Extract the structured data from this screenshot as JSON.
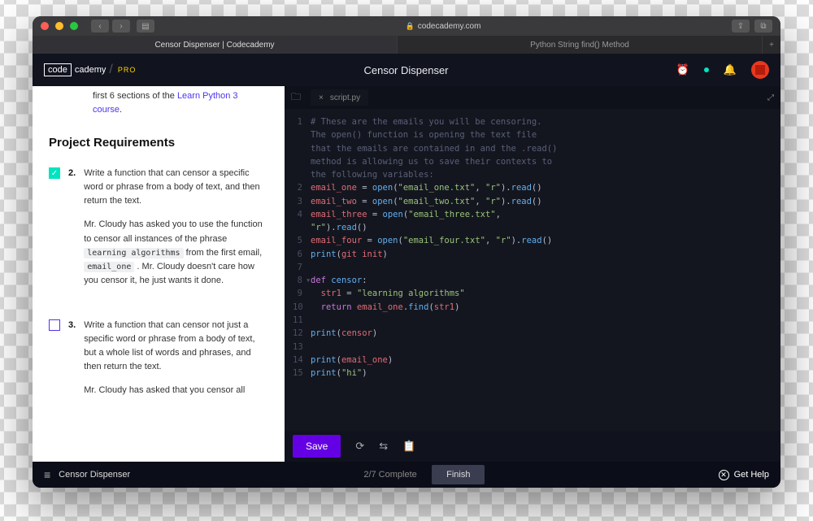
{
  "browser": {
    "url": "codecademy.com",
    "tabs": [
      "Censor Dispenser | Codecademy",
      "Python String find() Method"
    ]
  },
  "header": {
    "logo_box": "code",
    "logo_text": "cademy",
    "logo_pro": "PRO",
    "title": "Censor Dispenser"
  },
  "left": {
    "intro_prefix": "first 6 sections of the ",
    "intro_link": "Learn Python 3 course",
    "intro_suffix": ".",
    "section_title": "Project Requirements",
    "reqs": [
      {
        "n": "2.",
        "done": true,
        "p1": "Write a function that can censor a specific word or phrase from a body of text, and then return the text.",
        "p2a": "Mr. Cloudy has asked you to use the function to censor all instances of the phrase ",
        "p2code1": "learning algorithms",
        "p2b": " from the first email, ",
        "p2code2": "email_one",
        "p2c": " . Mr. Cloudy doesn't care how you censor it, he just wants it done."
      },
      {
        "n": "3.",
        "done": false,
        "p1": "Write a function that can censor not just a specific word or phrase from a body of text, but a whole list of words and phrases, and then return the text.",
        "p2": "Mr. Cloudy has asked that you censor all"
      }
    ]
  },
  "editor": {
    "filename": "script.py",
    "save": "Save"
  },
  "code_lines": [
    {
      "n": "1",
      "html": "<span class='cm'># These are the emails you will be censoring.</span>"
    },
    {
      "n": "",
      "html": "<span class='cm'>The open() function is opening the text file</span>"
    },
    {
      "n": "",
      "html": "<span class='cm'>that the emails are contained in and the .read()</span>"
    },
    {
      "n": "",
      "html": "<span class='cm'>method is allowing us to save their contexts to</span>"
    },
    {
      "n": "",
      "html": "<span class='cm'>the following variables:</span>"
    },
    {
      "n": "2",
      "html": "<span class='id'>email_one</span> <span class='op'>=</span> <span class='fn'>open</span>(<span class='str'>\"email_one.txt\"</span>, <span class='str'>\"r\"</span>).<span class='fn'>read</span>()"
    },
    {
      "n": "3",
      "html": "<span class='id'>email_two</span> <span class='op'>=</span> <span class='fn'>open</span>(<span class='str'>\"email_two.txt\"</span>, <span class='str'>\"r\"</span>).<span class='fn'>read</span>()"
    },
    {
      "n": "4",
      "html": "<span class='id'>email_three</span> <span class='op'>=</span> <span class='fn'>open</span>(<span class='str'>\"email_three.txt\"</span>,"
    },
    {
      "n": "",
      "html": "<span class='str'>\"r\"</span>).<span class='fn'>read</span>()"
    },
    {
      "n": "5",
      "html": "<span class='id'>email_four</span> <span class='op'>=</span> <span class='fn'>open</span>(<span class='str'>\"email_four.txt\"</span>, <span class='str'>\"r\"</span>).<span class='fn'>read</span>()"
    },
    {
      "n": "6",
      "html": "<span class='fn'>print</span>(<span class='id'>git</span> <span class='id'>init</span>)"
    },
    {
      "n": "7",
      "html": ""
    },
    {
      "n": "8",
      "html": "<span class='kw'>def</span> <span class='fn'>censor</span>:",
      "fold": true
    },
    {
      "n": "9",
      "html": "  <span class='id'>str1</span> <span class='op'>=</span> <span class='str'>\"learning algorithms\"</span>"
    },
    {
      "n": "10",
      "html": "  <span class='kw'>return</span> <span class='id'>email_one</span>.<span class='fn'>find</span>(<span class='id'>str1</span>)"
    },
    {
      "n": "11",
      "html": ""
    },
    {
      "n": "12",
      "html": "<span class='fn'>print</span>(<span class='id'>censor</span>)"
    },
    {
      "n": "13",
      "html": ""
    },
    {
      "n": "14",
      "html": "<span class='fn'>print</span>(<span class='id'>email_one</span>)"
    },
    {
      "n": "15",
      "html": "<span class='fn'>print</span>(<span class='str'>\"hi\"</span>)"
    }
  ],
  "footer": {
    "title": "Censor Dispenser",
    "progress": "2/7 Complete",
    "finish": "Finish",
    "help": "Get Help"
  }
}
